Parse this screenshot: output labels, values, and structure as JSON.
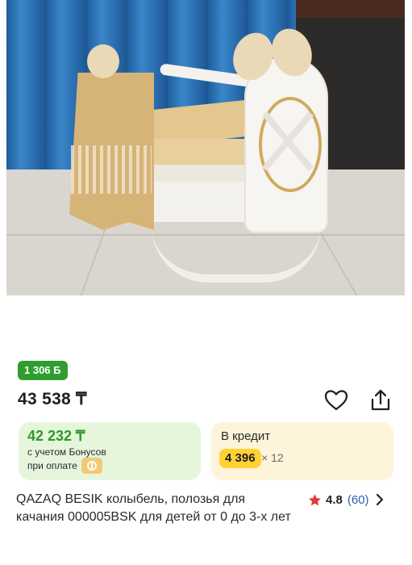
{
  "product": {
    "image_alt": "cradle photo",
    "bonus_badge": "1 306 Б",
    "price": "43 538 ₸",
    "title": "QAZAQ BESIK колыбель, полозья для качания 000005BSK для детей от 0 до 3-х лет"
  },
  "bonus_card": {
    "price": "42 232 ₸",
    "line1": "с учетом Бонусов",
    "line2": "при оплате"
  },
  "credit_card": {
    "label": "В кредит",
    "amount": "4 396",
    "months": "× 12"
  },
  "rating": {
    "value": "4.8",
    "count": "(60)"
  },
  "colors": {
    "green": "#2f9e2f",
    "bonus_bg": "#e6f6dc",
    "credit_bg": "#fdf4da",
    "credit_badge": "#ffd233",
    "star": "#e53935",
    "link": "#2b5fb0"
  },
  "icons": [
    "heart-icon",
    "share-icon",
    "payment-icon",
    "star-icon",
    "chevron-right-icon"
  ]
}
